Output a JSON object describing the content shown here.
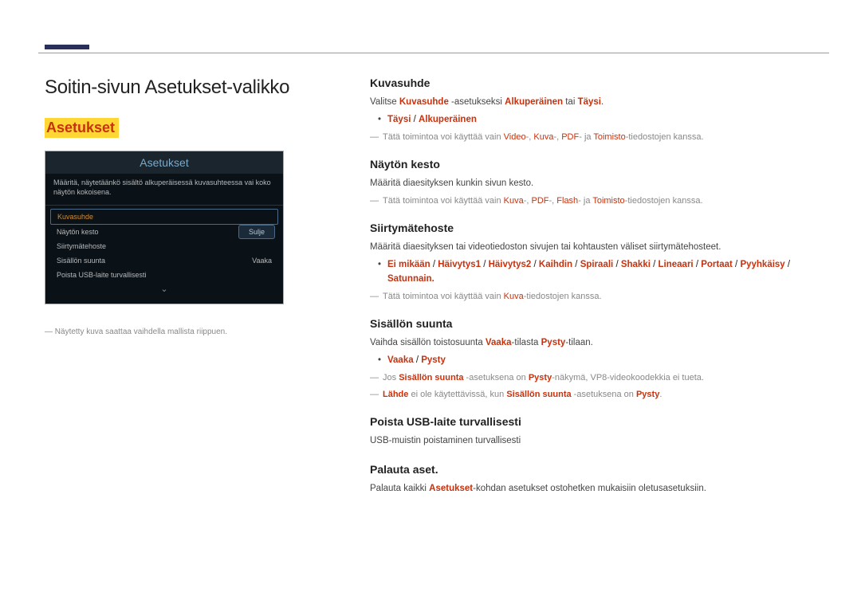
{
  "pageTitle": "Soitin-sivun Asetukset-valikko",
  "sectionTitle": "Asetukset",
  "shot": {
    "title": "Asetukset",
    "desc": "Määritä, näytetäänkö sisältö alkuperäisessä kuvasuhteessa vai koko näytön kokoisena.",
    "items": [
      {
        "label": "Kuvasuhde",
        "sel": true
      },
      {
        "label": "Näytön kesto"
      },
      {
        "label": "Siirtymätehoste"
      },
      {
        "label": "Sisällön suunta",
        "right": "Vaaka"
      },
      {
        "label": "Poista USB-laite turvallisesti"
      }
    ],
    "closeBtn": "Sulje"
  },
  "caption": "Näytetty kuva saattaa vaihdella mallista riippuen.",
  "sections": {
    "kuvasuhde": {
      "heading": "Kuvasuhde",
      "p1a": "Valitse ",
      "p1b": "Kuvasuhde",
      "p1c": " -asetukseksi ",
      "p1d": "Alkuperäinen",
      "p1e": " tai ",
      "p1f": "Täysi",
      "p1g": ".",
      "optA": "Täysi",
      "optB": "Alkuperäinen",
      "note_a": "Tätä toimintoa voi käyttää vain ",
      "note_v": "Video",
      "note_k": "Kuva",
      "note_p": "PDF",
      "note_t": "Toimisto",
      "note_z": "-tiedostojen kanssa."
    },
    "naytonkesto": {
      "heading": "Näytön kesto",
      "p1": "Määritä diaesityksen kunkin sivun kesto.",
      "note_a": "Tätä toimintoa voi käyttää vain ",
      "note_k": "Kuva",
      "note_p": "PDF",
      "note_f": "Flash",
      "note_t": "Toimisto",
      "note_z": "-tiedostojen kanssa."
    },
    "siirtyma": {
      "heading": "Siirtymätehoste",
      "p1": "Määritä diaesityksen tai videotiedoston sivujen tai kohtausten väliset siirtymätehosteet.",
      "opts": [
        "Ei mikään",
        "Häivytys1",
        "Häivytys2",
        "Kaihdin",
        "Spiraali",
        "Shakki",
        "Lineaari",
        "Portaat",
        "Pyyhkäisy",
        "Satunnain."
      ],
      "note_a": "Tätä toimintoa voi käyttää vain ",
      "note_k": "Kuva",
      "note_z": "-tiedostojen kanssa."
    },
    "sisallon": {
      "heading": "Sisällön suunta",
      "p1a": "Vaihda sisällön toistosuunta ",
      "p1b": "Vaaka",
      "p1c": "-tilasta ",
      "p1d": "Pysty",
      "p1e": "-tilaan.",
      "optA": "Vaaka",
      "optB": "Pysty",
      "note1a": "Jos ",
      "note1b": "Sisällön suunta",
      "note1c": " -asetuksena on ",
      "note1d": "Pysty",
      "note1e": "-näkymä, VP8-videokoodekkia ei tueta.",
      "note2a": "Lähde",
      "note2b": " ei ole käytettävissä, kun ",
      "note2c": "Sisällön suunta",
      "note2d": " -asetuksena on ",
      "note2e": "Pysty",
      "note2f": "."
    },
    "poistausb": {
      "heading": "Poista USB-laite turvallisesti",
      "p1": "USB-muistin poistaminen turvallisesti"
    },
    "palauta": {
      "heading": "Palauta aset.",
      "p1a": "Palauta kaikki ",
      "p1b": "Asetukset",
      "p1c": "-kohdan asetukset ostohetken mukaisiin oletusasetuksiin."
    }
  }
}
